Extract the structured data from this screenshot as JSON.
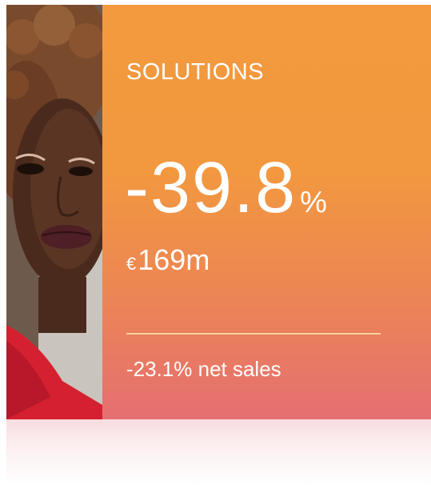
{
  "card": {
    "category": "SOLUTIONS",
    "change_value": "-39.8",
    "change_unit": "%",
    "currency": "€",
    "amount": "169m",
    "net_sales": "-23.1% net sales"
  },
  "colors": {
    "gradient_top": "#f39a3e",
    "gradient_bottom": "#e46f72",
    "divider": "#f6d59c",
    "text": "#ffffff"
  },
  "image": {
    "subject": "portrait of a woman with curly hair in a red top"
  }
}
